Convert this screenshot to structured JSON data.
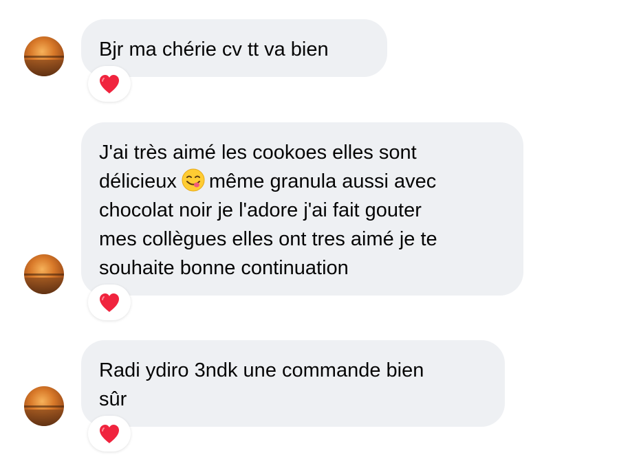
{
  "messages": [
    {
      "lines": [
        "Bjr ma chérie cv tt va bien"
      ],
      "reaction": "red-heart-icon"
    },
    {
      "lines": [
        "J'ai très aimé les cookoes elles sont",
        "délicieux",
        "même granula aussi avec",
        "chocolat noir je l'adore j'ai fait gouter",
        "mes collègues elles ont tres aimé je te",
        "souhaite bonne continuation"
      ],
      "emoji": "face-savoring-food-emoji",
      "reaction": "red-heart-icon"
    },
    {
      "lines": [
        "Radi ydiro 3ndk une commande bien",
        "sûr"
      ],
      "reaction": "red-heart-icon"
    }
  ],
  "colors": {
    "bubble": "#eef0f3",
    "text": "#050505",
    "heart": "#f0243e",
    "background": "#ffffff"
  }
}
